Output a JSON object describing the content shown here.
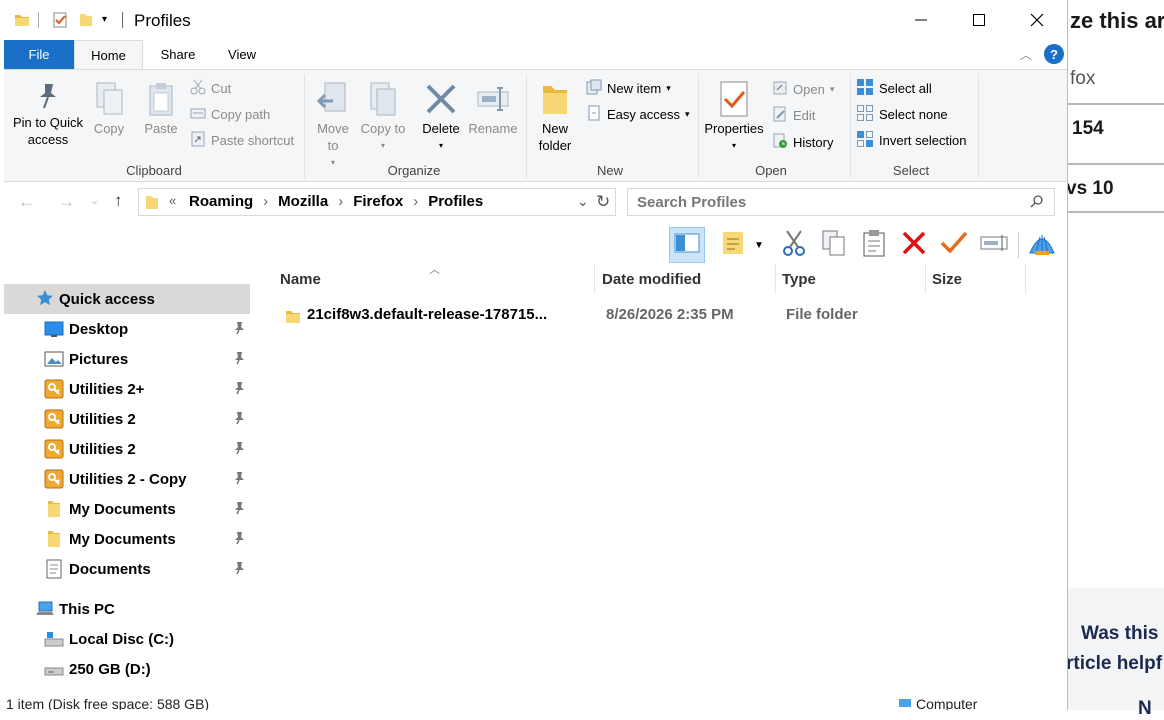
{
  "background": {
    "texts": [
      "ze this ar",
      "fox",
      "154",
      "vs 10",
      "Was this",
      "rticle helpf",
      "N"
    ]
  },
  "window": {
    "title": "Profiles",
    "tabs": [
      {
        "label": "File"
      },
      {
        "label": "Home"
      },
      {
        "label": "Share"
      },
      {
        "label": "View"
      }
    ],
    "help": "?"
  },
  "ribbon": {
    "clipboard": {
      "label": "Clipboard",
      "pin": "Pin to Quick access",
      "copy": "Copy",
      "paste": "Paste",
      "cut": "Cut",
      "copy_path": "Copy path",
      "paste_shortcut": "Paste shortcut"
    },
    "organize": {
      "label": "Organize",
      "move_to": "Move to",
      "copy_to": "Copy to",
      "delete": "Delete",
      "rename": "Rename"
    },
    "new": {
      "label": "New",
      "new_folder": "New folder",
      "new_item": "New item",
      "easy_access": "Easy access"
    },
    "open": {
      "label": "Open",
      "properties": "Properties",
      "open": "Open",
      "edit": "Edit",
      "history": "History"
    },
    "select": {
      "label": "Select",
      "select_all": "Select all",
      "select_none": "Select none",
      "invert": "Invert selection"
    }
  },
  "address": {
    "overflow": "«",
    "crumbs": [
      "Roaming",
      "Mozilla",
      "Firefox",
      "Profiles"
    ],
    "search_placeholder": "Search Profiles"
  },
  "sidebar": {
    "quick_access": "Quick access",
    "items": [
      {
        "label": "Desktop",
        "icon": "desktop-icon"
      },
      {
        "label": "Pictures",
        "icon": "pictures-icon"
      },
      {
        "label": "Utilities 2+",
        "icon": "key-folder-icon"
      },
      {
        "label": "Utilities 2",
        "icon": "key-folder-icon"
      },
      {
        "label": "Utilities 2",
        "icon": "key-folder-icon"
      },
      {
        "label": "Utilities 2 - Copy",
        "icon": "key-folder-icon"
      },
      {
        "label": "My Documents",
        "icon": "folder-icon"
      },
      {
        "label": "My Documents",
        "icon": "folder-icon"
      },
      {
        "label": "Documents",
        "icon": "documents-icon"
      }
    ],
    "this_pc": "This PC",
    "drives": [
      {
        "label": "Local Disc (C:)"
      },
      {
        "label": "250 GB (D:)"
      }
    ]
  },
  "columns": {
    "name": "Name",
    "date": "Date modified",
    "type": "Type",
    "size": "Size"
  },
  "files": [
    {
      "name": "21cif8w3.default-release-178715...",
      "date": "8/26/2026 2:35 PM",
      "type": "File folder",
      "size": ""
    }
  ],
  "status": {
    "left": "1 item (Disk free space: 588 GB)",
    "right": "Computer"
  },
  "colors": {
    "accent": "#1a6fc7",
    "selected": "#d9d9d9",
    "folder": "#f5c542"
  }
}
